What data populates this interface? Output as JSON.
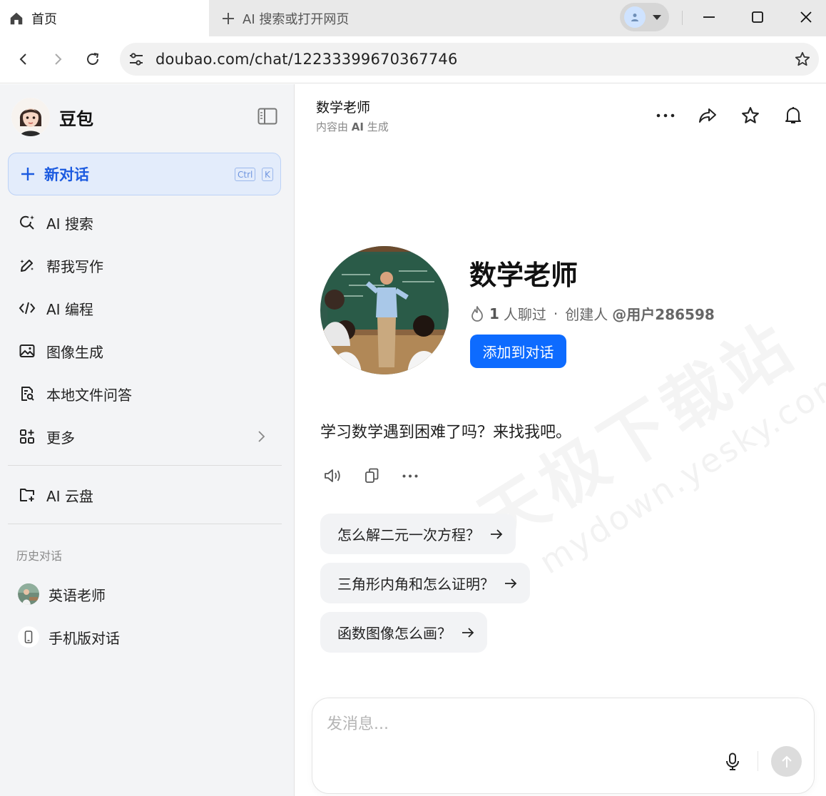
{
  "browser": {
    "active_tab": "首页",
    "new_tab": "AI 搜索或打开网页",
    "url": "doubao.com/chat/12233399670367746"
  },
  "sidebar": {
    "brand": "豆包",
    "new_chat": {
      "label": "新对话",
      "key1": "Ctrl",
      "key2": "K"
    },
    "items": [
      {
        "label": "AI 搜索",
        "icon": "ai-search-icon"
      },
      {
        "label": "帮我写作",
        "icon": "pen-sparkle-icon"
      },
      {
        "label": "AI 编程",
        "icon": "code-icon"
      },
      {
        "label": "图像生成",
        "icon": "image-icon"
      },
      {
        "label": "本地文件问答",
        "icon": "file-search-icon"
      },
      {
        "label": "更多",
        "icon": "grid-icon"
      }
    ],
    "cloud": "AI 云盘",
    "history_title": "历史对话",
    "history": [
      {
        "label": "英语老师"
      },
      {
        "label": "手机版对话"
      }
    ]
  },
  "header": {
    "title": "数学老师",
    "subtitle_prefix": "内容由",
    "subtitle_ai": "AI",
    "subtitle_suffix": "生成"
  },
  "bot": {
    "name": "数学老师",
    "chat_count": "1",
    "chat_suffix": "人聊过",
    "dot": "·",
    "creator_prefix": "创建人",
    "creator": "@用户286598",
    "add_button": "添加到对话"
  },
  "welcome_message": "学习数学遇到困难了吗？来找我吧。",
  "suggestions": [
    "怎么解二元一次方程？",
    "三角形内角和怎么证明？",
    "函数图像怎么画？"
  ],
  "composer": {
    "placeholder": "发消息..."
  },
  "watermark": {
    "cn": "天极下载站",
    "en": "mydown.yesky.com"
  },
  "colors": {
    "accent": "#0d6bff",
    "new_chat_bg": "#e3ecfb",
    "sidebar_bg": "#f3f4f6"
  }
}
